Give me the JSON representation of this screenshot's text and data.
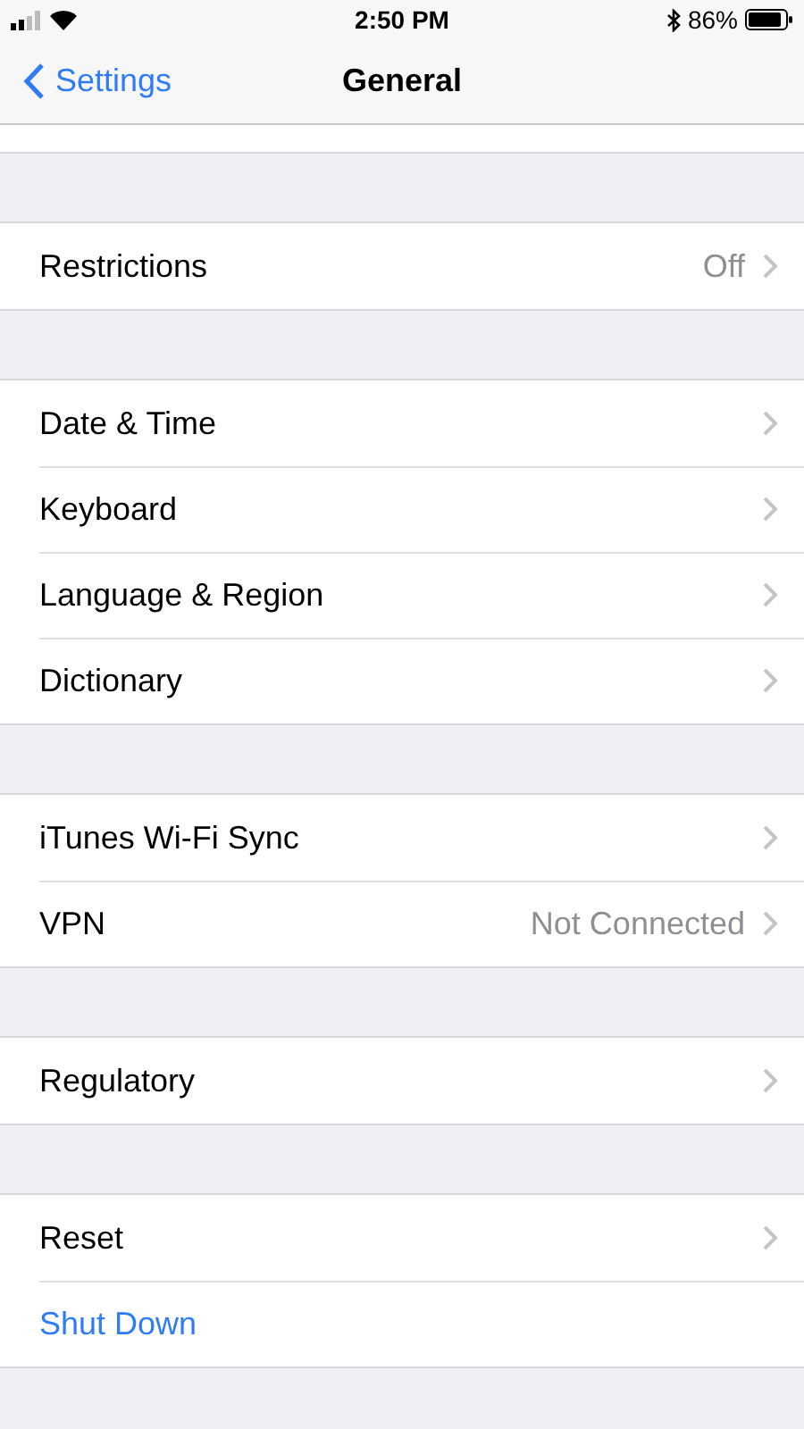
{
  "status_bar": {
    "time": "2:50 PM",
    "battery": "86%"
  },
  "nav": {
    "back": "Settings",
    "title": "General"
  },
  "groups": [
    {
      "rows": [
        {
          "kind": "chevron",
          "label": "Restrictions",
          "value": "Off"
        }
      ]
    },
    {
      "rows": [
        {
          "kind": "chevron",
          "label": "Date & Time"
        },
        {
          "kind": "chevron",
          "label": "Keyboard"
        },
        {
          "kind": "chevron",
          "label": "Language & Region"
        },
        {
          "kind": "chevron",
          "label": "Dictionary"
        }
      ]
    },
    {
      "rows": [
        {
          "kind": "chevron",
          "label": "iTunes Wi-Fi Sync"
        },
        {
          "kind": "chevron",
          "label": "VPN",
          "value": "Not Connected"
        }
      ]
    },
    {
      "rows": [
        {
          "kind": "chevron",
          "label": "Regulatory"
        }
      ]
    },
    {
      "rows": [
        {
          "kind": "chevron",
          "label": "Reset"
        },
        {
          "kind": "action",
          "label": "Shut Down"
        }
      ]
    }
  ]
}
